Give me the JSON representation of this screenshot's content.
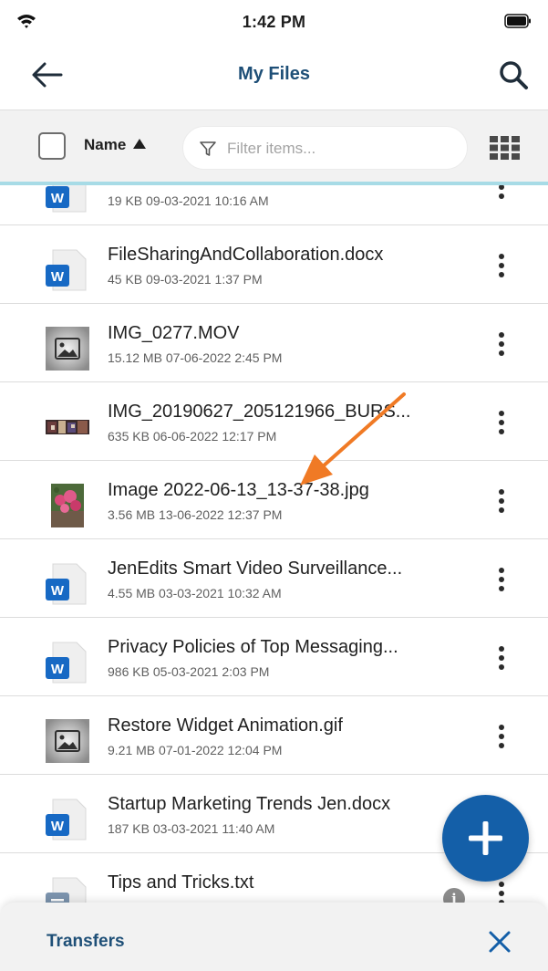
{
  "status_bar": {
    "time": "1:42 PM"
  },
  "nav": {
    "title": "My Files",
    "back_icon": "arrow-left-icon",
    "search_icon": "search-icon"
  },
  "toolbar": {
    "sort_label": "Name",
    "sort_direction": "ascending",
    "filter_placeholder": "Filter items...",
    "view_icon": "grid-view-icon"
  },
  "files": [
    {
      "name": "",
      "meta": "19 KB 09-03-2021 10:16 AM",
      "icon": "word-doc-icon"
    },
    {
      "name": "FileSharingAndCollaboration.docx",
      "meta": "45 KB 09-03-2021 1:37 PM",
      "icon": "word-doc-icon"
    },
    {
      "name": "IMG_0277.MOV",
      "meta": "15.12 MB 07-06-2022 2:45 PM",
      "icon": "image-placeholder-icon"
    },
    {
      "name": "IMG_20190627_205121966_BURS...",
      "meta": "635 KB 06-06-2022 12:17 PM",
      "icon": "photo-thumbnail"
    },
    {
      "name": "Image 2022-06-13_13-37-38.jpg",
      "meta": "3.56 MB 13-06-2022 12:37 PM",
      "icon": "photo-thumbnail"
    },
    {
      "name": "JenEdits Smart Video Surveillance...",
      "meta": "4.55 MB 03-03-2021 10:32 AM",
      "icon": "word-doc-icon"
    },
    {
      "name": "Privacy Policies of Top Messaging...",
      "meta": "986 KB 05-03-2021 2:03 PM",
      "icon": "word-doc-icon"
    },
    {
      "name": "Restore Widget Animation.gif",
      "meta": "9.21 MB 07-01-2022 12:04 PM",
      "icon": "image-placeholder-icon"
    },
    {
      "name": "Startup Marketing Trends Jen.docx",
      "meta": "187 KB 03-03-2021 11:40 AM",
      "icon": "word-doc-icon"
    },
    {
      "name": "Tips and Tricks.txt",
      "meta": "",
      "icon": "text-doc-icon"
    }
  ],
  "fab": {
    "icon": "plus-icon"
  },
  "transfers": {
    "title": "Transfers",
    "close_icon": "close-icon"
  },
  "colors": {
    "accent": "#145fa8",
    "title": "#1e4f77",
    "word_blue": "#1769c4",
    "divider": "#a7dbe6"
  }
}
